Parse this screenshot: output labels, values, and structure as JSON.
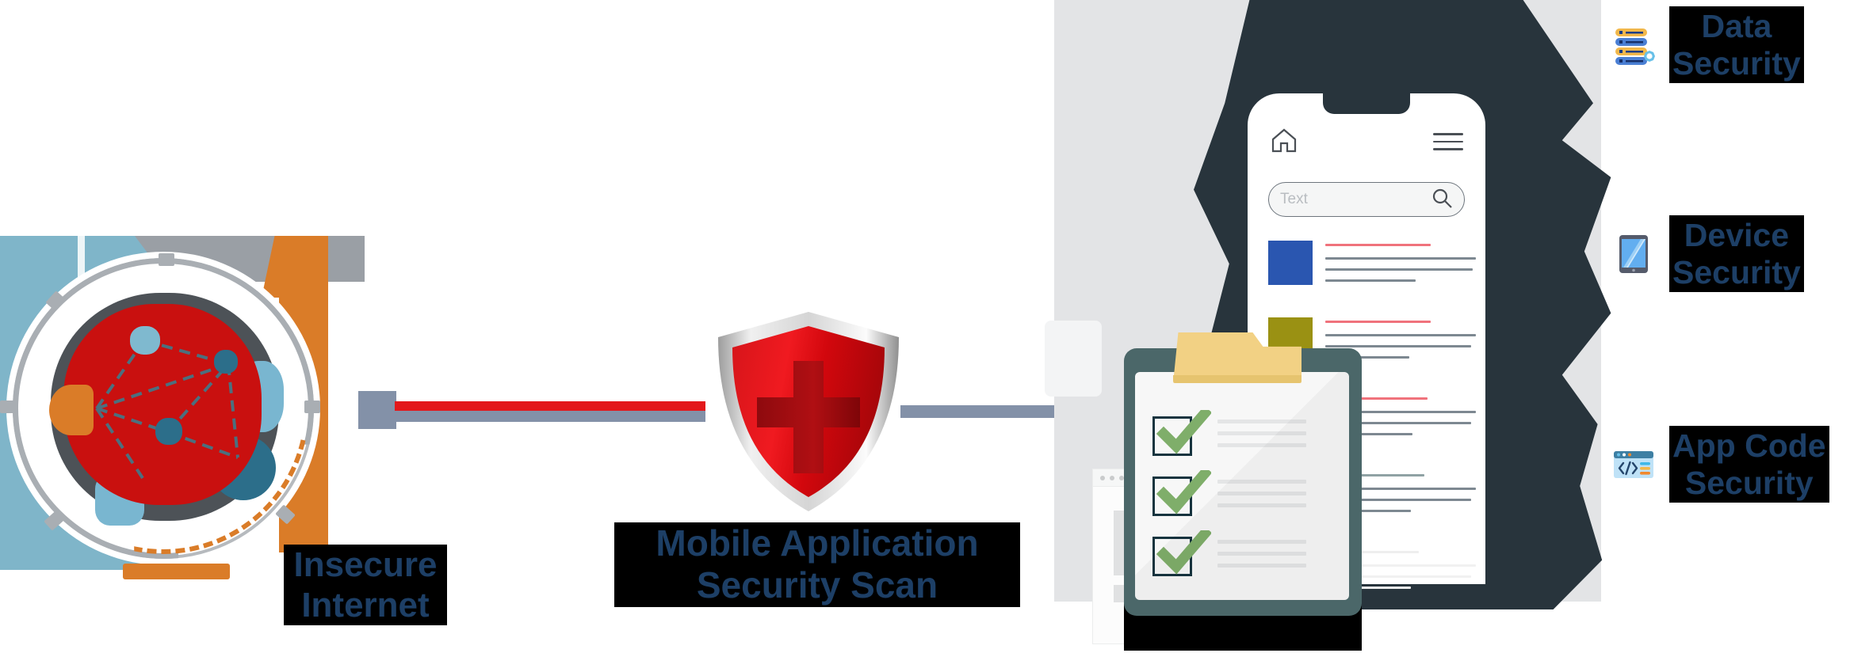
{
  "title": "Mobile Application Security Scan diagram",
  "colors": {
    "label_text": "#1d3f66",
    "label_bg": "#000000",
    "accent_red": "#e3181b",
    "accent_orange": "#da7c28",
    "accent_blue": "#7fb5c9",
    "connector_gray": "#8391a8",
    "blob_navy": "#28343c",
    "clipboard_teal": "#4b6769",
    "check_green": "#7fae6a",
    "panel_gray": "#e3e4e6"
  },
  "left": {
    "icon_name": "insecure-internet-globe-icon",
    "caption": "Insecure\nInternet"
  },
  "center": {
    "icon_name": "red-shield-with-cross-icon",
    "caption": "Mobile Application\nSecurity Scan"
  },
  "connectors": [
    {
      "name": "globe-to-shield-connector",
      "from": "insecure-internet",
      "to": "security-shield",
      "colors": [
        "#e3181b",
        "#8391a8"
      ]
    },
    {
      "name": "shield-to-app-connector",
      "from": "security-shield",
      "to": "mobile-app-checklist",
      "colors": [
        "#8391a8"
      ]
    }
  ],
  "phone": {
    "home_icon": "home-icon",
    "menu_icon": "hamburger-menu-icon",
    "search_placeholder": "Text",
    "search_icon": "search-icon",
    "rows": [
      {
        "thumb": "#2a56b0",
        "title_color": "#f0727c"
      },
      {
        "thumb": "#9a9113",
        "title_color": "#f0727c"
      },
      {
        "thumb": "#ef4a5c",
        "title_color": "#f0727c"
      },
      {
        "thumb": "#a32435",
        "title_color": "#8fa2a4"
      },
      {
        "thumb": "#e3e4e6",
        "title_color": "#eeeeee"
      }
    ]
  },
  "checklist": {
    "name": "mobile-app-checklist",
    "items_checked": 3
  },
  "side_items": [
    {
      "icon": "database-server-gear-icon",
      "label": "Data\nSecurity"
    },
    {
      "icon": "tablet-device-icon",
      "label": "Device\nSecurity"
    },
    {
      "icon": "code-window-icon",
      "label": "App Code\nSecurity"
    }
  ]
}
